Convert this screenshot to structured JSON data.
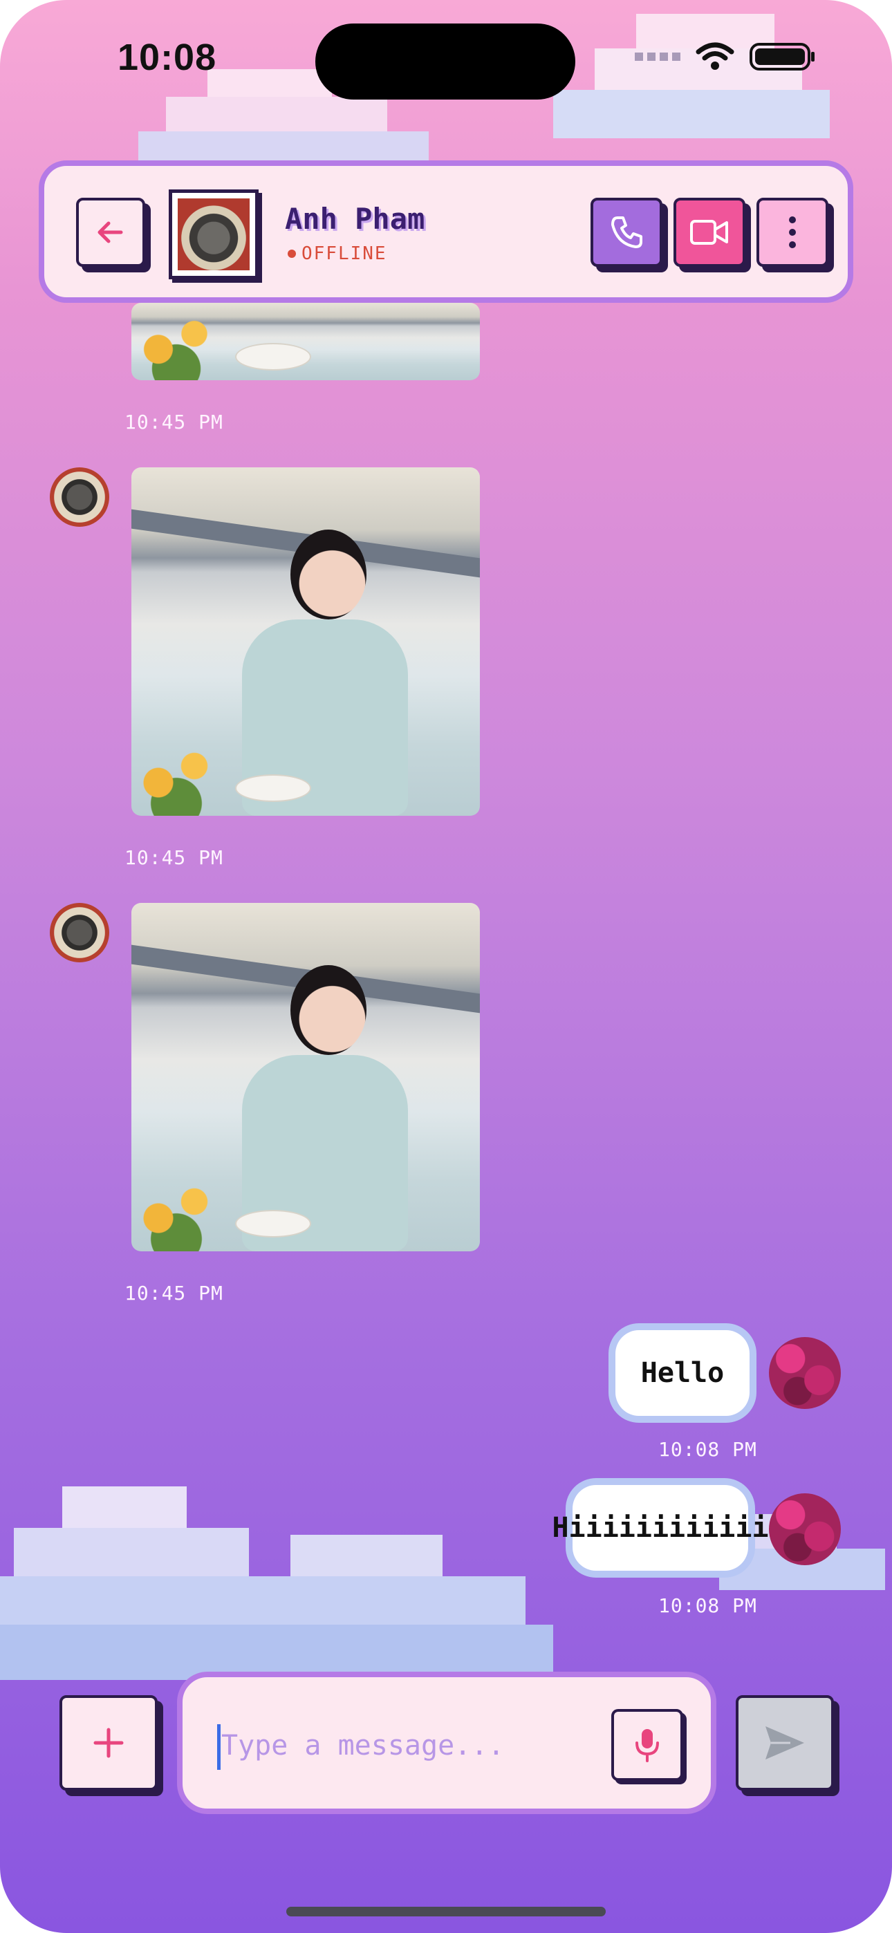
{
  "status_bar": {
    "time": "10:08"
  },
  "header": {
    "contact_name": "Anh Pham",
    "contact_status": "OFFLINE"
  },
  "messages": [
    {
      "type": "image",
      "sender": "contact",
      "timestamp": "10:45 PM"
    },
    {
      "type": "image",
      "sender": "contact",
      "timestamp": "10:45 PM"
    },
    {
      "type": "image",
      "sender": "contact",
      "timestamp": "10:45 PM"
    },
    {
      "type": "text",
      "sender": "me",
      "text": "Hello",
      "timestamp": "10:08 PM"
    },
    {
      "type": "text",
      "sender": "me",
      "text": "Hiiiiiiiiiiii",
      "timestamp": "10:08 PM"
    }
  ],
  "composer": {
    "placeholder": "Type a message..."
  },
  "icons": {
    "back": "arrow-left-icon",
    "call": "phone-icon",
    "video": "video-camera-icon",
    "more": "more-vertical-icon",
    "add": "plus-icon",
    "mic": "microphone-icon",
    "send": "send-icon"
  },
  "colors": {
    "accent_purple": "#b57ae6",
    "call_button": "#a36cdd",
    "video_button": "#f0559a",
    "more_button": "#fbb5dd",
    "offline_red": "#d94c3a",
    "bubble_outline": "#b7c7f4"
  }
}
